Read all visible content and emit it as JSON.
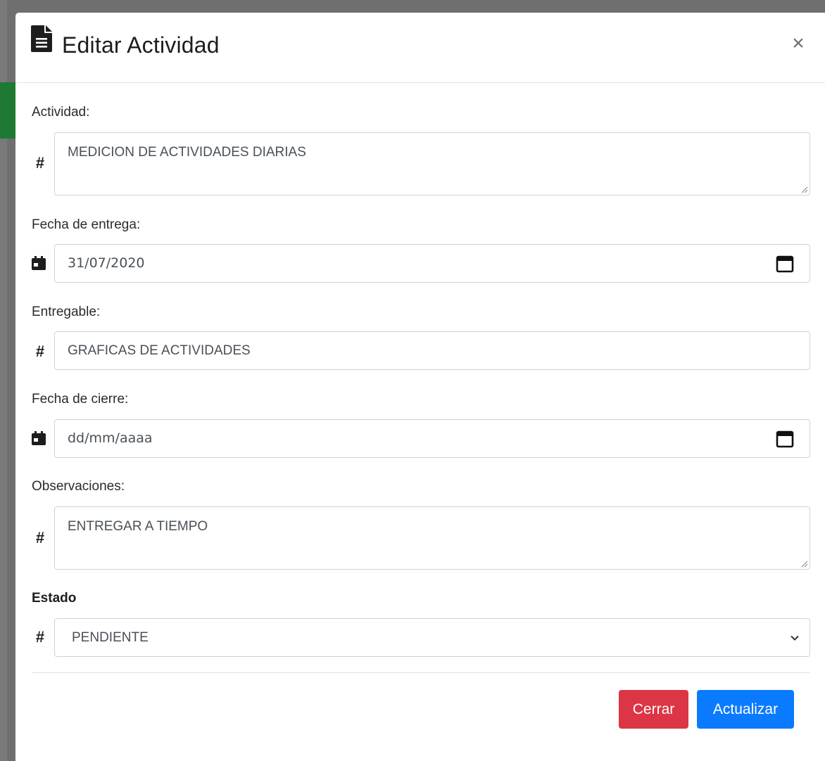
{
  "modal": {
    "title": "Editar Actividad",
    "close_glyph": "×",
    "icons": {
      "header": "file-text-icon",
      "close": "close-icon"
    }
  },
  "form": {
    "actividad": {
      "label": "Actividad:",
      "prefix": "#",
      "value": "MEDICION DE ACTIVIDADES DIARIAS"
    },
    "fecha_entrega": {
      "label": "Fecha de entrega:",
      "prefix_icon": "calendar-icon",
      "value": "31/07/2020"
    },
    "entregable": {
      "label": "Entregable:",
      "prefix": "#",
      "value": "GRAFICAS DE ACTIVIDADES"
    },
    "fecha_cierre": {
      "label": "Fecha de cierre:",
      "prefix_icon": "calendar-icon",
      "placeholder": "dd/mm/aaaa"
    },
    "observaciones": {
      "label": "Observaciones:",
      "prefix": "#",
      "value": "ENTREGAR A TIEMPO"
    },
    "estado": {
      "label": "Estado",
      "prefix": "#",
      "selected": "PENDIENTE"
    }
  },
  "footer": {
    "cerrar_label": "Cerrar",
    "actualizar_label": "Actualizar"
  },
  "colors": {
    "danger": "#dc3545",
    "primary": "#0a7bff",
    "backdrop": "#6f6f6f",
    "backdrop_accent": "#1e7a32"
  }
}
